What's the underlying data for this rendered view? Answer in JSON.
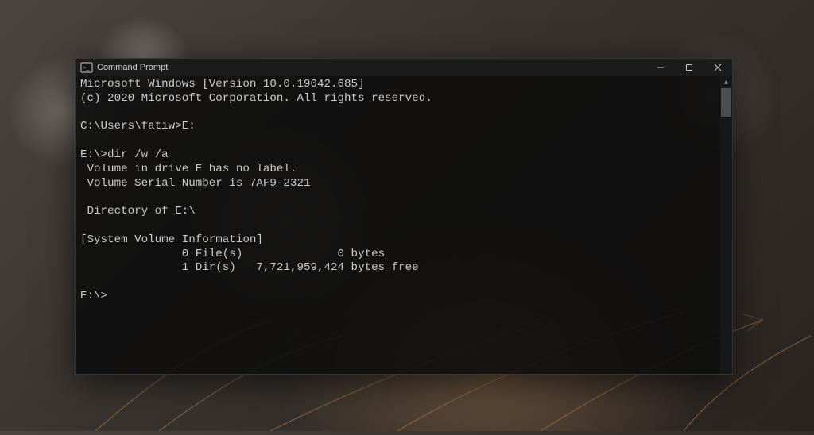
{
  "window": {
    "title": "Command Prompt"
  },
  "terminal": {
    "lines": {
      "l0": "Microsoft Windows [Version 10.0.19042.685]",
      "l1": "(c) 2020 Microsoft Corporation. All rights reserved.",
      "l2": "",
      "l3": "C:\\Users\\fatiw>E:",
      "l4": "",
      "l5": "E:\\>dir /w /a",
      "l6": " Volume in drive E has no label.",
      "l7": " Volume Serial Number is 7AF9-2321",
      "l8": "",
      "l9": " Directory of E:\\",
      "l10": "",
      "l11": "[System Volume Information]",
      "l12": "               0 File(s)              0 bytes",
      "l13": "               1 Dir(s)   7,721,959,424 bytes free",
      "l14": "",
      "l15": "E:\\>"
    }
  }
}
